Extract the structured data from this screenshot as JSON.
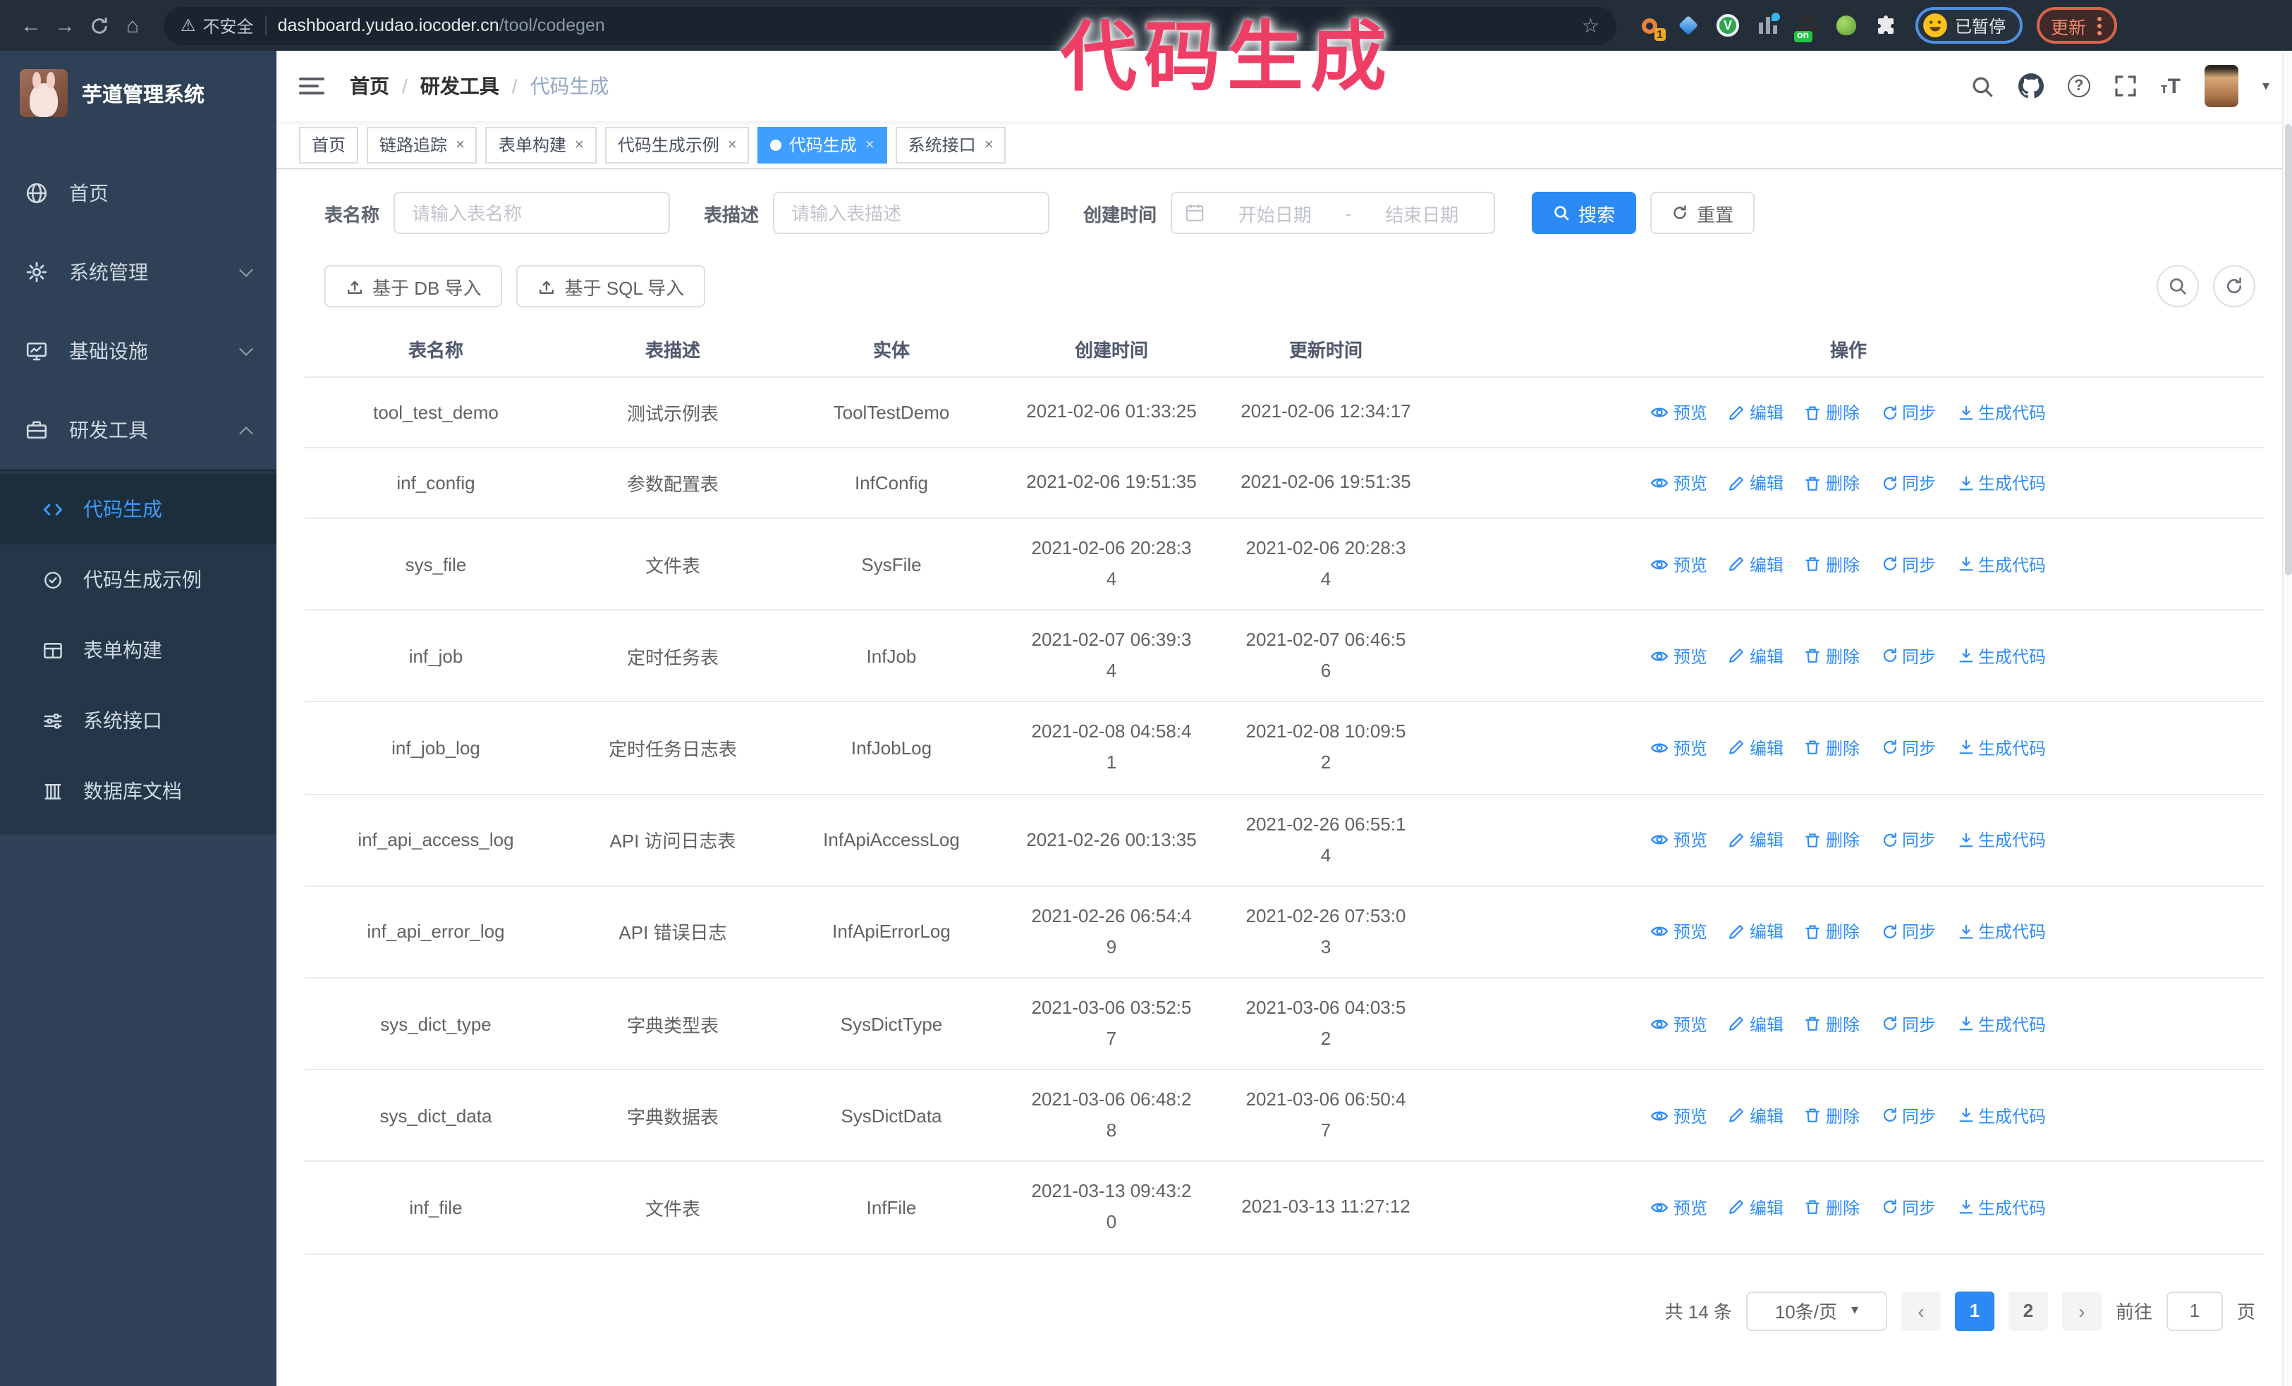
{
  "browser": {
    "security_label": "不安全",
    "url_host": "dashboard.yudao.iocoder.cn",
    "url_path": "/tool/codegen",
    "extension_badge": "1",
    "extension_on_badge": "on",
    "extension_v_letter": "V",
    "profile_badge": "已暂停",
    "update_label": "更新"
  },
  "overlay": {
    "text": "代码生成"
  },
  "colors": {
    "accent": "#409eff",
    "sidebar_bg": "#2e4156",
    "submenu_bg": "#233748",
    "overlay_pink": "#ee3e66",
    "chrome_bg": "#232e39"
  },
  "sidebar": {
    "logo_title": "芋道管理系统",
    "items": [
      {
        "label": "首页"
      },
      {
        "label": "系统管理"
      },
      {
        "label": "基础设施"
      },
      {
        "label": "研发工具"
      }
    ],
    "subitems": [
      {
        "label": "代码生成"
      },
      {
        "label": "代码生成示例"
      },
      {
        "label": "表单构建"
      },
      {
        "label": "系统接口"
      },
      {
        "label": "数据库文档"
      }
    ]
  },
  "navbar": {
    "breadcrumb": [
      "首页",
      "研发工具",
      "代码生成"
    ]
  },
  "tabs": [
    {
      "label": "首页"
    },
    {
      "label": "链路追踪"
    },
    {
      "label": "表单构建"
    },
    {
      "label": "代码生成示例"
    },
    {
      "label": "代码生成"
    },
    {
      "label": "系统接口"
    }
  ],
  "search_form": {
    "name_label": "表名称",
    "name_placeholder": "请输入表名称",
    "desc_label": "表描述",
    "desc_placeholder": "请输入表描述",
    "time_label": "创建时间",
    "start_placeholder": "开始日期",
    "range_separator": "-",
    "end_placeholder": "结束日期",
    "search_label": "搜索",
    "reset_label": "重置"
  },
  "toolbar": {
    "import_db_label": "基于 DB 导入",
    "import_sql_label": "基于 SQL 导入"
  },
  "table": {
    "columns": [
      "表名称",
      "表描述",
      "实体",
      "创建时间",
      "更新时间",
      "操作"
    ],
    "actions": [
      "预览",
      "编辑",
      "删除",
      "同步",
      "生成代码"
    ],
    "rows": [
      {
        "name": "tool_test_demo",
        "desc": "测试示例表",
        "entity": "ToolTestDemo",
        "created": "2021-02-06 01:33:25",
        "updated": "2021-02-06 12:34:17"
      },
      {
        "name": "inf_config",
        "desc": "参数配置表",
        "entity": "InfConfig",
        "created": "2021-02-06 19:51:35",
        "updated": "2021-02-06 19:51:35"
      },
      {
        "name": "sys_file",
        "desc": "文件表",
        "entity": "SysFile",
        "created": "2021-02-06 20:28:3\n4",
        "updated": "2021-02-06 20:28:3\n4"
      },
      {
        "name": "inf_job",
        "desc": "定时任务表",
        "entity": "InfJob",
        "created": "2021-02-07 06:39:3\n4",
        "updated": "2021-02-07 06:46:5\n6"
      },
      {
        "name": "inf_job_log",
        "desc": "定时任务日志表",
        "entity": "InfJobLog",
        "created": "2021-02-08 04:58:4\n1",
        "updated": "2021-02-08 10:09:5\n2"
      },
      {
        "name": "inf_api_access_log",
        "desc": "API 访问日志表",
        "entity": "InfApiAccessLog",
        "created": "2021-02-26 00:13:35",
        "updated": "2021-02-26 06:55:1\n4"
      },
      {
        "name": "inf_api_error_log",
        "desc": "API 错误日志",
        "entity": "InfApiErrorLog",
        "created": "2021-02-26 06:54:4\n9",
        "updated": "2021-02-26 07:53:0\n3"
      },
      {
        "name": "sys_dict_type",
        "desc": "字典类型表",
        "entity": "SysDictType",
        "created": "2021-03-06 03:52:5\n7",
        "updated": "2021-03-06 04:03:5\n2"
      },
      {
        "name": "sys_dict_data",
        "desc": "字典数据表",
        "entity": "SysDictData",
        "created": "2021-03-06 06:48:2\n8",
        "updated": "2021-03-06 06:50:4\n7"
      },
      {
        "name": "inf_file",
        "desc": "文件表",
        "entity": "InfFile",
        "created": "2021-03-13 09:43:2\n0",
        "updated": "2021-03-13 11:27:12"
      }
    ]
  },
  "pagination": {
    "total_label": "共 14 条",
    "page_size": "10条/页",
    "pages": [
      "1",
      "2"
    ],
    "active_page": "1",
    "goto_label": "前往",
    "goto_value": "1",
    "page_unit": "页"
  }
}
